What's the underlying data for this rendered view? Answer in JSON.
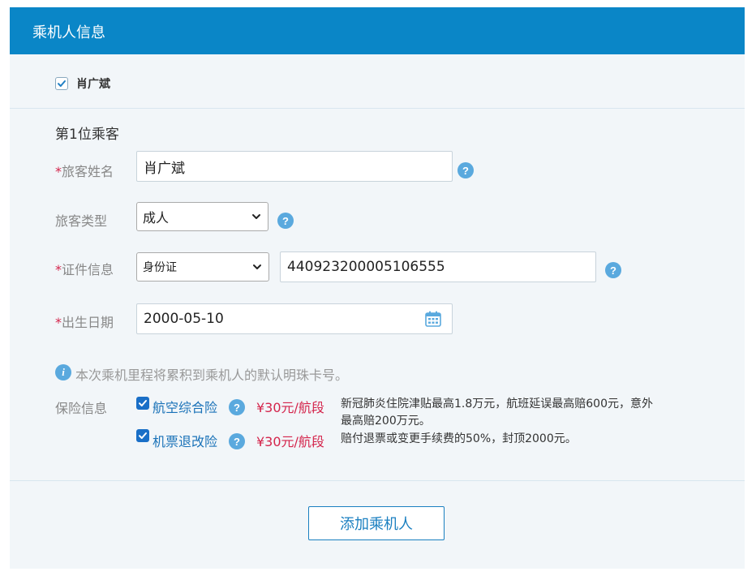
{
  "panel": {
    "title": "乘机人信息"
  },
  "contacts": [
    {
      "name": "肖广斌",
      "checked": true
    }
  ],
  "passenger": {
    "section_title": "第1位乘客",
    "required_mark": "*",
    "name_label": "旅客姓名",
    "name_value": "肖广斌",
    "type_label": "旅客类型",
    "type_value": "成人",
    "id_label": "证件信息",
    "id_type_value": "身份证",
    "id_number_value": "440923200005106555",
    "birth_label": "出生日期",
    "birth_value": "2000-05-10"
  },
  "tip": {
    "text": "本次乘机里程将累积到乘机人的默认明珠卡号。"
  },
  "insurance": {
    "label": "保险信息",
    "items": [
      {
        "name": "航空综合险",
        "price": "¥30元/航段",
        "desc": "新冠肺炎住院津贴最高1.8万元，航班延误最高赔600元，意外最高赔200万元。",
        "checked": true
      },
      {
        "name": "机票退改险",
        "price": "¥30元/航段",
        "desc": "赔付退票或变更手续费的50%，封顶2000元。",
        "checked": true
      }
    ]
  },
  "actions": {
    "add_passenger": "添加乘机人"
  },
  "icons": {
    "help": "help-circle-icon",
    "info": "info-circle-icon",
    "calendar": "calendar-icon",
    "dropdown": "chevron-down-icon",
    "check": "checkmark-icon"
  },
  "colors": {
    "header": "#0a86c7",
    "panel_bg": "#f2f6f9",
    "required": "#d4254c",
    "link": "#1a72b8",
    "price": "#d4254c",
    "help": "#5aa9de"
  }
}
